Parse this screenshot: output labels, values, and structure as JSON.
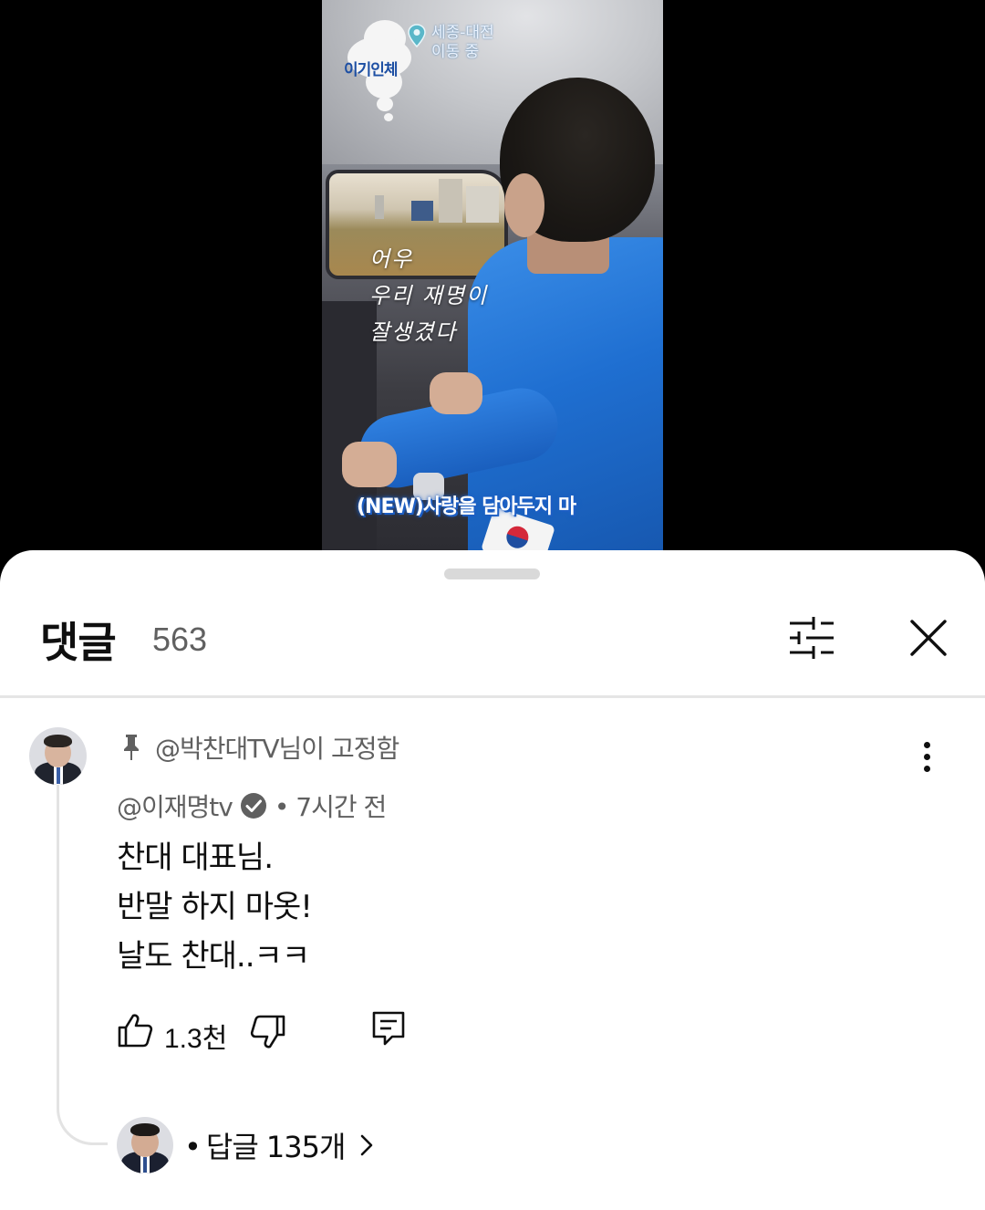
{
  "video": {
    "location_line1": "세종-대전",
    "location_line2": "이동 중",
    "channel_logo_text": "이기인체",
    "handwritten_lines": [
      "어우",
      "우리 재명이",
      "잘생겼다"
    ],
    "music_caption": "(NEW)사랑을 담아두지 마",
    "icons": [
      "location-pin-icon",
      "cloud-logo-icon"
    ]
  },
  "sheet": {
    "title": "댓글",
    "count": "563",
    "icons": [
      "filter-icon",
      "close-icon"
    ]
  },
  "comment": {
    "pinned_by": "@박찬대TV님이 고정함",
    "author": "@이재명tv",
    "time": "• 7시간 전",
    "lines": [
      "찬대 대표님.",
      "반말 하지 마옷!",
      "날도 찬대..ㅋㅋ"
    ],
    "like_count": "1.3",
    "like_count_unit": "천",
    "replies_label": "답글 135개",
    "icons": [
      "pin-icon",
      "verified-icon",
      "like-icon",
      "dislike-icon",
      "reply-icon",
      "more-vert-icon",
      "chevron-right-icon"
    ]
  },
  "colors": {
    "jacket_blue": "#1f6fd1",
    "caption_glow": "#1e5fc4",
    "secondary_text": "#606060",
    "primary_text": "#0f0f0f"
  }
}
